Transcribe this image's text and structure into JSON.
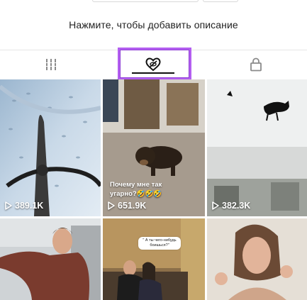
{
  "profile": {
    "description_prompt": "Нажмите, чтобы добавить описание"
  },
  "tabs": [
    {
      "id": "videos",
      "icon": "grid-icon"
    },
    {
      "id": "liked",
      "icon": "hidden-heart-icon",
      "active": true
    },
    {
      "id": "private",
      "icon": "lock-icon"
    }
  ],
  "videos": [
    {
      "views": "389.1K",
      "caption": ""
    },
    {
      "views": "651.9K",
      "caption": "Почему мне так угарно?🤣🤣🤣"
    },
    {
      "views": "382.3K",
      "caption": ""
    },
    {
      "views": "",
      "caption": ""
    },
    {
      "views": "",
      "caption": "\" А ты чего-нибудь боишься?\""
    },
    {
      "views": "",
      "caption": ""
    }
  ],
  "colors": {
    "highlight": "#b35ef0",
    "text": "#222222"
  }
}
